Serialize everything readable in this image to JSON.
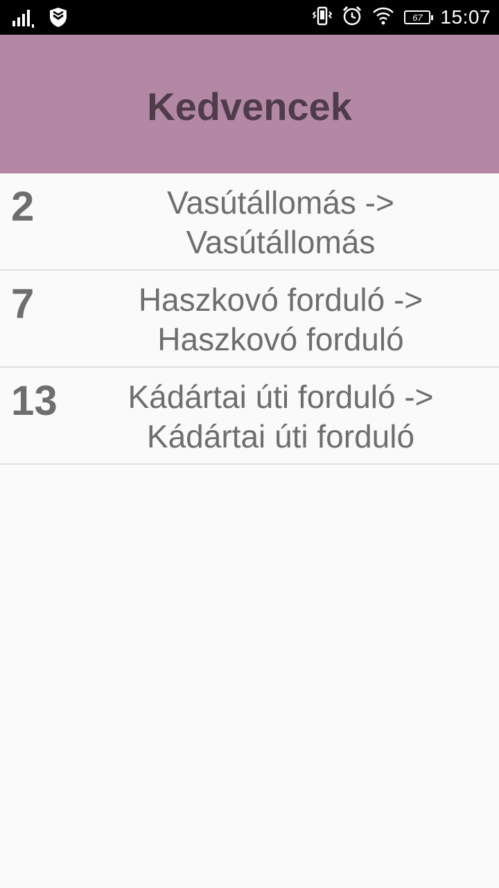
{
  "status_bar": {
    "time": "15:07",
    "battery_level": "67",
    "icons": [
      "signal-icon",
      "shield-icon",
      "vibrate-icon",
      "alarm-icon",
      "wifi-icon",
      "battery-icon"
    ]
  },
  "app_bar": {
    "title": "Kedvencek",
    "background_color": "#b388a4",
    "title_color": "#4f3b4a"
  },
  "favorites": [
    {
      "line": "2",
      "from": "Vasútállomás  ->",
      "to": "Vasútállomás"
    },
    {
      "line": "7",
      "from": "Haszkovó forduló  ->",
      "to": "Haszkovó forduló"
    },
    {
      "line": "13",
      "from": "Kádártai úti forduló  ->",
      "to": "Kádártai úti forduló"
    }
  ]
}
